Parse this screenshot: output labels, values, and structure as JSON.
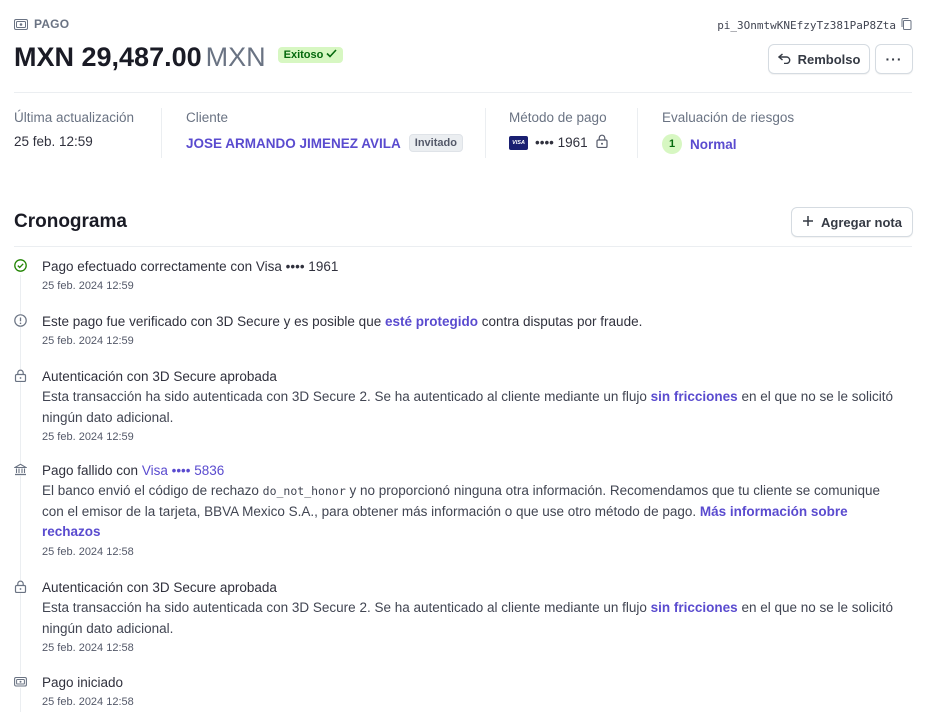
{
  "header": {
    "section_label": "PAGO",
    "payment_id": "pi_3OnmtwKNEfzyTz381PaP8Zta",
    "amount": "MXN 29,487.00",
    "currency": "MXN",
    "status": "Exitoso",
    "refund_label": "Rembolso",
    "more_label": "···"
  },
  "summary": {
    "last_update_label": "Última actualización",
    "last_update_value": "25 feb. 12:59",
    "customer_label": "Cliente",
    "customer_name": "JOSE ARMANDO JIMENEZ AVILA",
    "customer_badge": "Invitado",
    "payment_method_label": "Método de pago",
    "card_brand_text": "VISA",
    "card_last4": "•••• 1961",
    "risk_label": "Evaluación de riesgos",
    "risk_score": "1",
    "risk_value": "Normal"
  },
  "timeline": {
    "title": "Cronograma",
    "add_note_label": "Agregar nota",
    "events": [
      {
        "icon": "check-circle-icon",
        "title": "Pago efectuado correctamente con Visa •••• 1961",
        "timestamp": "25 feb. 2024 12:59"
      },
      {
        "icon": "info-circle-icon",
        "title_pre": "Este pago fue verificado con 3D Secure y es posible que ",
        "title_link": "esté protegido",
        "title_post": " contra disputas por fraude.",
        "timestamp": "25 feb. 2024 12:59"
      },
      {
        "icon": "lock-icon",
        "title": "Autenticación con 3D Secure aprobada",
        "desc_pre": "Esta transacción ha sido autenticada con 3D Secure 2. Se ha autenticado al cliente mediante un flujo ",
        "desc_link": "sin fricciones",
        "desc_post": " en el que no se le solicitó ningún dato adicional.",
        "timestamp": "25 feb. 2024 12:59"
      },
      {
        "icon": "bank-icon",
        "title_pre": "Pago fallido con ",
        "title_link": "Visa •••• 5836",
        "desc_pre": "El banco envió el código de rechazo ",
        "desc_code": "do_not_honor",
        "desc_mid": " y no proporcionó ninguna otra información. Recomendamos que tu cliente se comunique con el emisor de la tarjeta, BBVA Mexico S.A., para obtener más información o que use otro método de pago. ",
        "desc_link": "Más información sobre rechazos",
        "timestamp": "25 feb. 2024 12:58"
      },
      {
        "icon": "lock-icon",
        "title": "Autenticación con 3D Secure aprobada",
        "desc_pre": "Esta transacción ha sido autenticada con 3D Secure 2. Se ha autenticado al cliente mediante un flujo ",
        "desc_link": "sin fricciones",
        "desc_post": " en el que no se le solicitó ningún dato adicional.",
        "timestamp": "25 feb. 2024 12:58"
      },
      {
        "icon": "payment-icon",
        "title": "Pago iniciado",
        "timestamp": "25 feb. 2024 12:58"
      }
    ]
  },
  "colors": {
    "accent": "#5a4bcf",
    "success_bg": "#d7f7c2",
    "success_text": "#05690d",
    "visa_blue": "#1a1f71"
  }
}
